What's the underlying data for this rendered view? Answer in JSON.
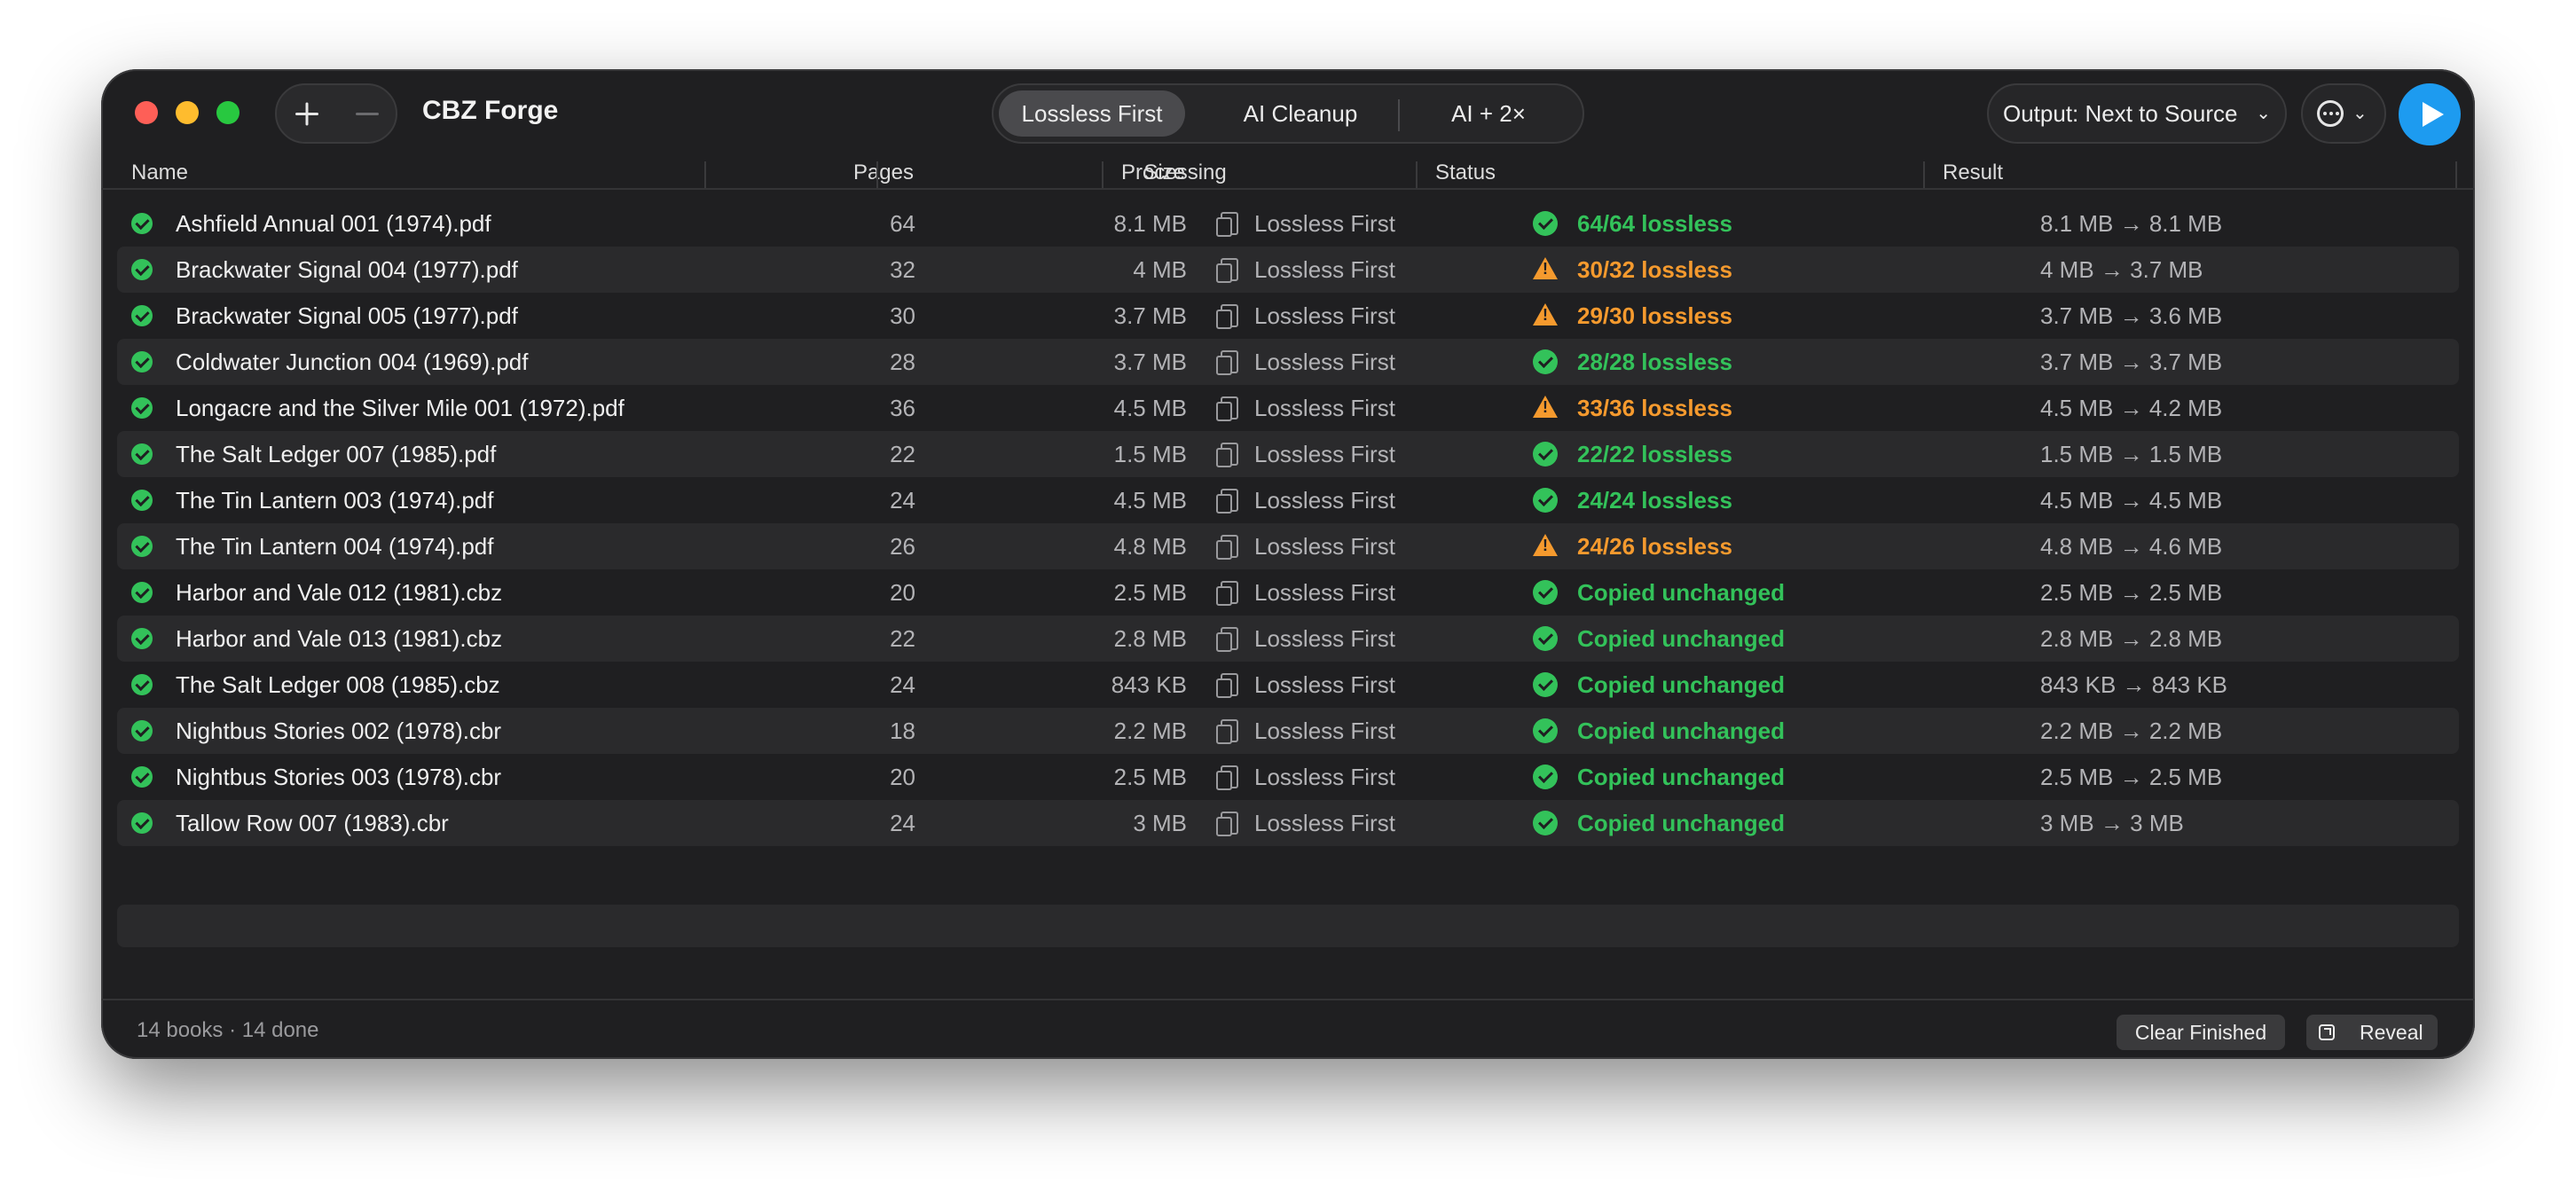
{
  "app": {
    "title": "CBZ Forge"
  },
  "toolbar": {
    "modes": [
      "Lossless First",
      "AI Cleanup",
      "AI + 2×"
    ],
    "selected_mode": "Lossless First",
    "output_label": "Output: Next to Source",
    "more_icon": "ellipsis-circle-icon",
    "start_icon": "play-icon"
  },
  "table": {
    "columns": {
      "name": "Name",
      "pages": "Pages",
      "size": "Size",
      "processing": "Processing",
      "status": "Status",
      "result": "Result"
    },
    "rows": [
      {
        "name": "Ashfield Annual 001 (1974).pdf",
        "pages": "64",
        "size": "8.1 MB",
        "processing": "Lossless First",
        "status": "64/64 lossless",
        "status_kind": "ok",
        "result": "8.1 MB → 8.1 MB"
      },
      {
        "name": "Brackwater Signal 004 (1977).pdf",
        "pages": "32",
        "size": "4 MB",
        "processing": "Lossless First",
        "status": "30/32 lossless",
        "status_kind": "warn",
        "result": "4 MB → 3.7 MB"
      },
      {
        "name": "Brackwater Signal 005 (1977).pdf",
        "pages": "30",
        "size": "3.7 MB",
        "processing": "Lossless First",
        "status": "29/30 lossless",
        "status_kind": "warn",
        "result": "3.7 MB → 3.6 MB"
      },
      {
        "name": "Coldwater Junction 004 (1969).pdf",
        "pages": "28",
        "size": "3.7 MB",
        "processing": "Lossless First",
        "status": "28/28 lossless",
        "status_kind": "ok",
        "result": "3.7 MB → 3.7 MB"
      },
      {
        "name": "Longacre and the Silver Mile 001 (1972).pdf",
        "pages": "36",
        "size": "4.5 MB",
        "processing": "Lossless First",
        "status": "33/36 lossless",
        "status_kind": "warn",
        "result": "4.5 MB → 4.2 MB"
      },
      {
        "name": "The Salt Ledger 007 (1985).pdf",
        "pages": "22",
        "size": "1.5 MB",
        "processing": "Lossless First",
        "status": "22/22 lossless",
        "status_kind": "ok",
        "result": "1.5 MB → 1.5 MB"
      },
      {
        "name": "The Tin Lantern 003 (1974).pdf",
        "pages": "24",
        "size": "4.5 MB",
        "processing": "Lossless First",
        "status": "24/24 lossless",
        "status_kind": "ok",
        "result": "4.5 MB → 4.5 MB"
      },
      {
        "name": "The Tin Lantern 004 (1974).pdf",
        "pages": "26",
        "size": "4.8 MB",
        "processing": "Lossless First",
        "status": "24/26 lossless",
        "status_kind": "warn",
        "result": "4.8 MB → 4.6 MB"
      },
      {
        "name": "Harbor and Vale 012 (1981).cbz",
        "pages": "20",
        "size": "2.5 MB",
        "processing": "Lossless First",
        "status": "Copied unchanged",
        "status_kind": "ok",
        "result": "2.5 MB → 2.5 MB"
      },
      {
        "name": "Harbor and Vale 013 (1981).cbz",
        "pages": "22",
        "size": "2.8 MB",
        "processing": "Lossless First",
        "status": "Copied unchanged",
        "status_kind": "ok",
        "result": "2.8 MB → 2.8 MB"
      },
      {
        "name": "The Salt Ledger 008 (1985).cbz",
        "pages": "24",
        "size": "843 KB",
        "processing": "Lossless First",
        "status": "Copied unchanged",
        "status_kind": "ok",
        "result": "843 KB → 843 KB"
      },
      {
        "name": "Nightbus Stories 002 (1978).cbr",
        "pages": "18",
        "size": "2.2 MB",
        "processing": "Lossless First",
        "status": "Copied unchanged",
        "status_kind": "ok",
        "result": "2.2 MB → 2.2 MB"
      },
      {
        "name": "Nightbus Stories 003 (1978).cbr",
        "pages": "20",
        "size": "2.5 MB",
        "processing": "Lossless First",
        "status": "Copied unchanged",
        "status_kind": "ok",
        "result": "2.5 MB → 2.5 MB"
      },
      {
        "name": "Tallow Row 007 (1983).cbr",
        "pages": "24",
        "size": "3 MB",
        "processing": "Lossless First",
        "status": "Copied unchanged",
        "status_kind": "ok",
        "result": "3 MB → 3 MB"
      }
    ]
  },
  "footer": {
    "summary": "14 books · 14 done",
    "clear_label": "Clear Finished",
    "reveal_label": "Reveal"
  },
  "colors": {
    "accent": "#1d9bf0",
    "ok": "#33c25a",
    "warn": "#f59a2e",
    "background": "#1f1f21"
  }
}
